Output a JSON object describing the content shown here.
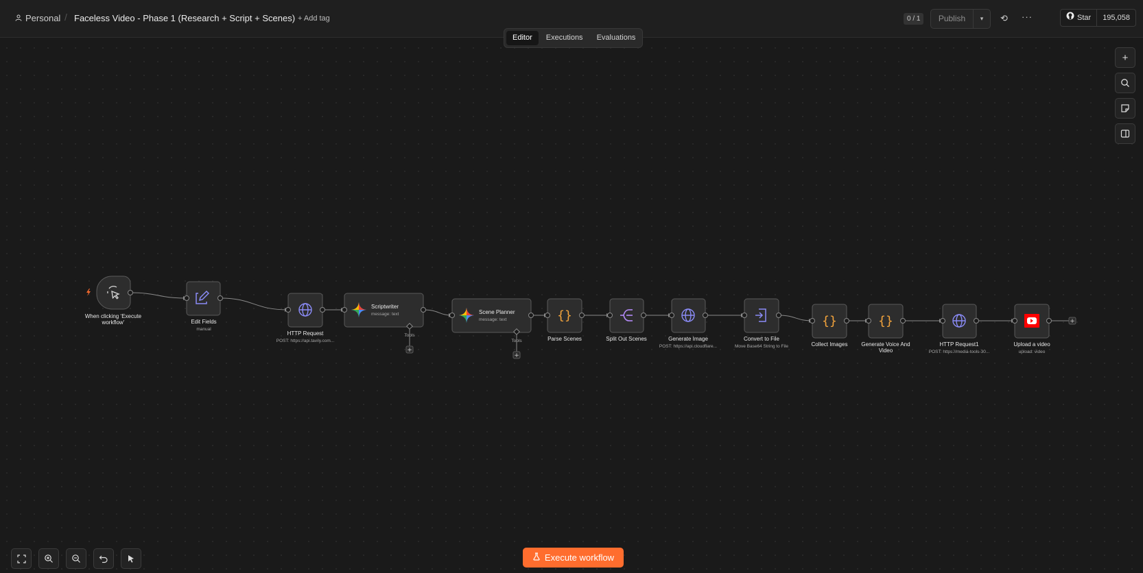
{
  "header": {
    "project": "Personal",
    "title": "Faceless Video - Phase 1 (Research + Script + Scenes)",
    "add_tag": "+ Add tag",
    "counter": "0 / 1",
    "publish": "Publish",
    "github_star": "Star",
    "github_count": "195,058"
  },
  "tabs": [
    "Editor",
    "Executions",
    "Evaluations"
  ],
  "execute": "Execute workflow",
  "tools_label": "Tools",
  "nodes": [
    {
      "label": "When clicking ‘Execute",
      "label2": "workflow’",
      "sub": "",
      "icon": "cursor-icon"
    },
    {
      "label": "Edit Fields",
      "label2": "",
      "sub": "manual",
      "icon": "edit-icon"
    },
    {
      "label": "HTTP Request",
      "label2": "",
      "sub": "POST: https://api.tavily.com...",
      "icon": "globe-icon"
    },
    {
      "label": "Scriptwriter",
      "label2": "",
      "sub": "message: text",
      "icon": "gemini-icon"
    },
    {
      "label": "Scene Planner",
      "label2": "",
      "sub": "message: text",
      "icon": "gemini-icon"
    },
    {
      "label": "Parse Scenes",
      "label2": "",
      "sub": "",
      "icon": "code-icon"
    },
    {
      "label": "Split Out Scenes",
      "label2": "",
      "sub": "",
      "icon": "split-icon"
    },
    {
      "label": "Generate Image",
      "label2": "",
      "sub": "POST: https://api.cloudflare...",
      "icon": "globe-icon"
    },
    {
      "label": "Convert to File",
      "label2": "",
      "sub": "Move Base64 String to File",
      "icon": "file-icon"
    },
    {
      "label": "Collect Images",
      "label2": "",
      "sub": "",
      "icon": "code-icon"
    },
    {
      "label": "Generate Voice And",
      "label2": "Video",
      "sub": "",
      "icon": "code-icon"
    },
    {
      "label": "HTTP Request1",
      "label2": "",
      "sub": "POST: https://media-tools-30...",
      "icon": "globe-icon"
    },
    {
      "label": "Upload a video",
      "label2": "",
      "sub": "upload: video",
      "icon": "youtube-icon"
    }
  ],
  "colors": {
    "accent": "#ff6d2e",
    "globe": "#8b8cf8",
    "code": "#f2a33c",
    "split": "#b38af8",
    "youtube": "#ff0000"
  }
}
